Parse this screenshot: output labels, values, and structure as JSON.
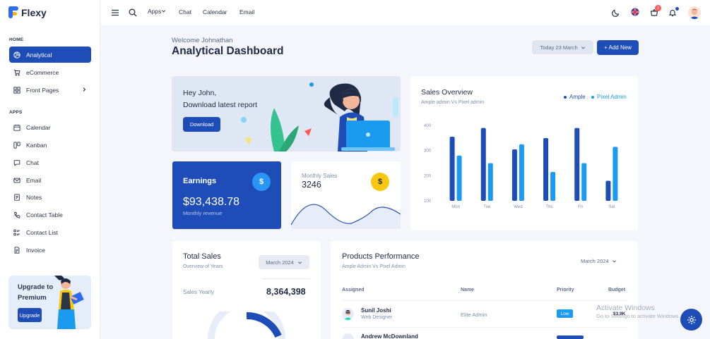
{
  "app": {
    "name": "Flexy"
  },
  "sidebar": {
    "sections": [
      {
        "title": "HOME"
      },
      {
        "title": "APPS"
      }
    ],
    "items": [
      {
        "label": "Analytical",
        "icon": "aperture-icon",
        "active": true
      },
      {
        "label": "eCommerce",
        "icon": "cart-icon"
      },
      {
        "label": "Front Pages",
        "icon": "grid-icon"
      },
      {
        "label": "Calendar",
        "icon": "calendar-icon"
      },
      {
        "label": "Kanban",
        "icon": "kanban-icon"
      },
      {
        "label": "Chat",
        "icon": "chat-icon"
      },
      {
        "label": "Email",
        "icon": "mail-icon"
      },
      {
        "label": "Notes",
        "icon": "notes-icon"
      },
      {
        "label": "Contact Table",
        "icon": "phone-icon"
      },
      {
        "label": "Contact List",
        "icon": "list-icon"
      },
      {
        "label": "Invoice",
        "icon": "invoice-icon"
      }
    ],
    "upgrade": {
      "title": "Upgrade to Premium",
      "button": "Upgrade"
    }
  },
  "header": {
    "links": [
      "Apps",
      "Chat",
      "Calendar",
      "Email"
    ],
    "cart_count": "2"
  },
  "page": {
    "welcome": "Welcome Johnathan",
    "title": "Analytical Dashboard",
    "date_button": "Today 23 March",
    "add_button": "+ Add New"
  },
  "download_card": {
    "line1": "Hey John,",
    "line2": "Download latest report",
    "button": "Download"
  },
  "earnings": {
    "title": "Earnings",
    "icon": "$",
    "value": "$93,438.78",
    "sub": "Monthly revenue"
  },
  "monthly_sales": {
    "label": "Monthly Sales",
    "value": "3246",
    "icon": "$"
  },
  "sales_overview": {
    "title": "Sales Overview",
    "subtitle": "Ample admin Vs Pixel admin",
    "colors": {
      "ample": "#1e4db7",
      "pixel": "#1b9bef"
    }
  },
  "chart_data": {
    "type": "bar",
    "categories": [
      "Mon",
      "Tue",
      "Wed",
      "Thu",
      "Fri",
      "Sat"
    ],
    "series": [
      {
        "name": "Ample",
        "values": [
          355,
          390,
          305,
          350,
          390,
          180
        ]
      },
      {
        "name": "Pixel Admin",
        "values": [
          280,
          250,
          325,
          215,
          250,
          315
        ]
      }
    ],
    "yticks": [
      100,
      200,
      300,
      400
    ],
    "ylim": [
      100,
      400
    ],
    "legend": "top-right",
    "grid": false
  },
  "total_sales": {
    "title": "Total Sales",
    "subtitle": "Overview of Years",
    "select": "March 2024",
    "yearly_label": "Sales Yearly",
    "yearly_value": "8,364,398"
  },
  "products": {
    "title": "Products Performance",
    "subtitle": "Ample Admin Vs Pixel Admin",
    "select": "March 2024",
    "columns": [
      "Assigned",
      "Name",
      "Priority",
      "Budget"
    ],
    "rows": [
      {
        "name": "Sunil Joshi",
        "role": "Web Designer",
        "project": "Elite Admin",
        "priority": "Low",
        "budget": "$3.9K"
      },
      {
        "name": "Andrew McDownland",
        "role": "",
        "project": "",
        "priority": "",
        "budget": ""
      }
    ]
  },
  "watermark": {
    "line1": "Activate Windows",
    "line2": "Go to Settings to activate Windows."
  }
}
